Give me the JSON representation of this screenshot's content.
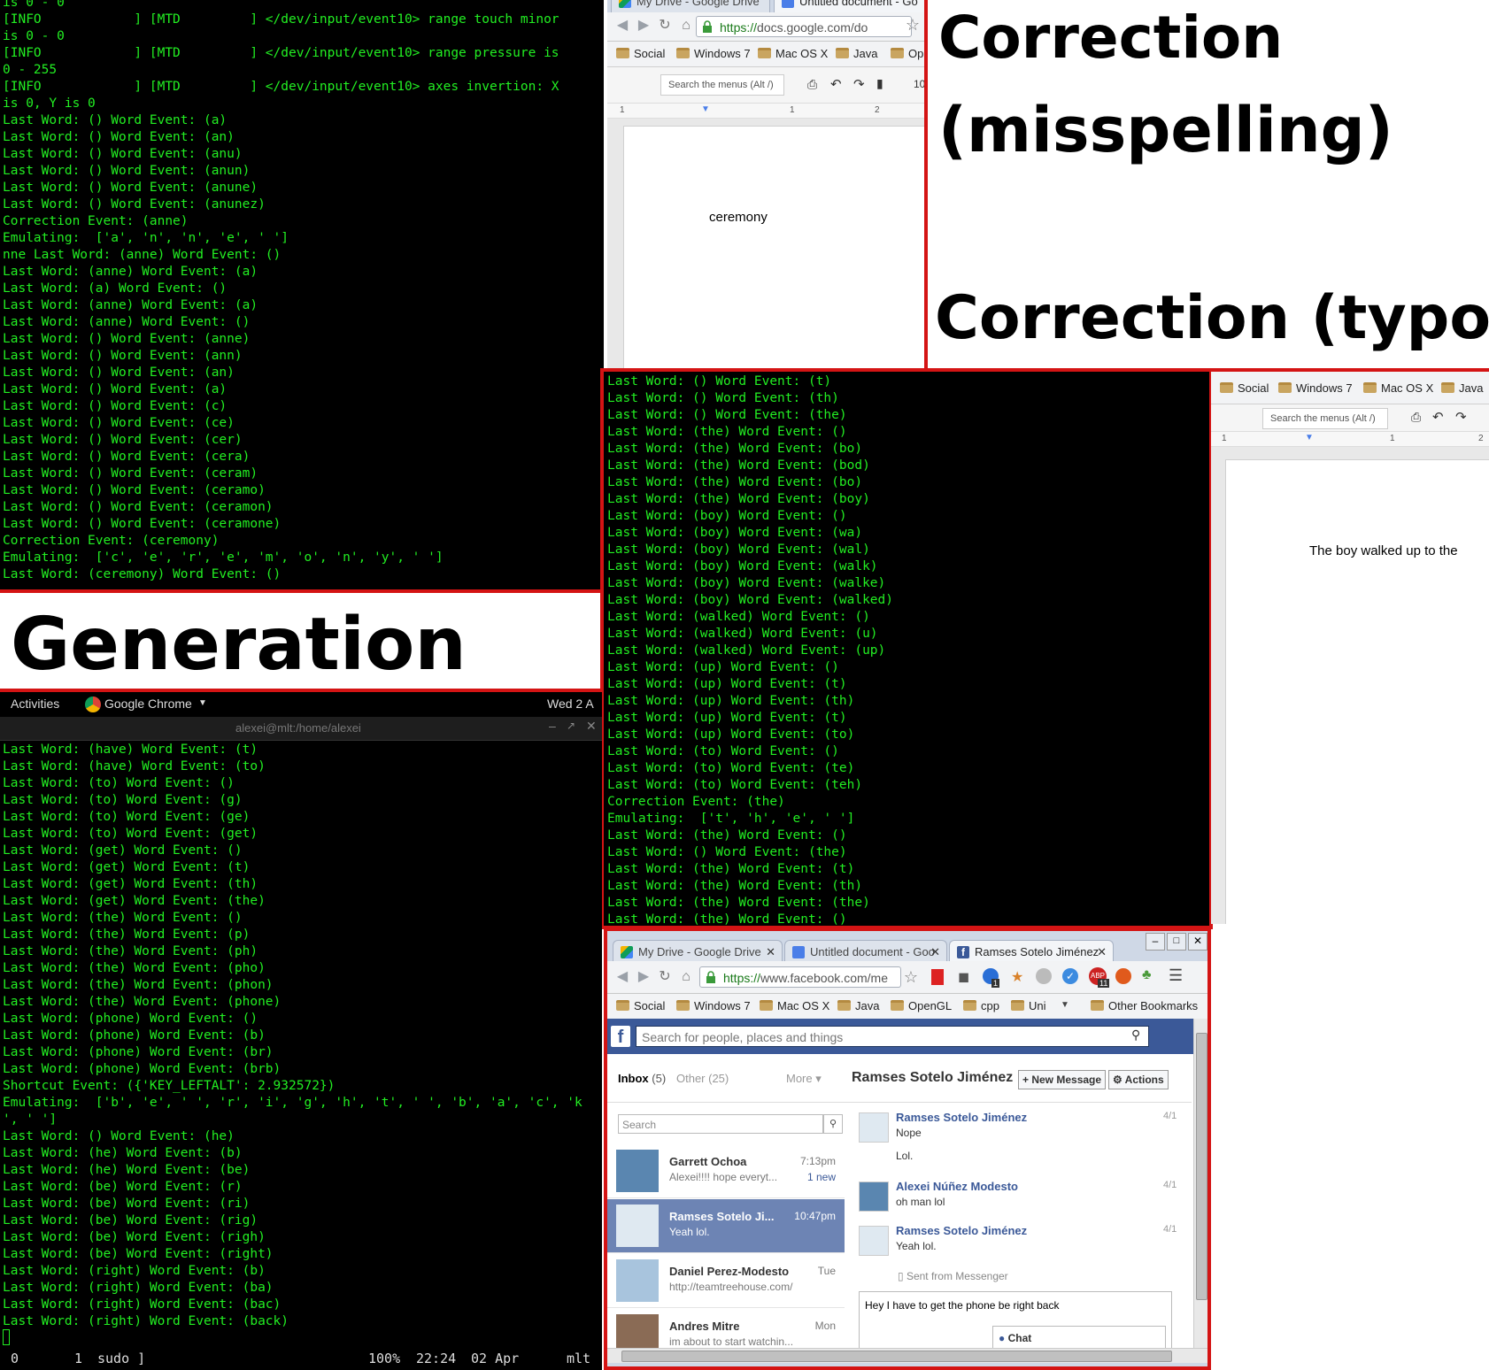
{
  "terminal_top": {
    "lines": [
      "is 0 - 0",
      "[INFO            ] [MTD         ] </dev/input/event10> range touch minor",
      "is 0 - 0",
      "[INFO            ] [MTD         ] </dev/input/event10> range pressure is",
      "0 - 255",
      "[INFO            ] [MTD         ] </dev/input/event10> axes invertion: X",
      "is 0, Y is 0",
      "Last Word: () Word Event: (a)",
      "Last Word: () Word Event: (an)",
      "Last Word: () Word Event: (anu)",
      "Last Word: () Word Event: (anun)",
      "Last Word: () Word Event: (anune)",
      "Last Word: () Word Event: (anunez)",
      "Correction Event: (anne)",
      "Emulating:  ['a', 'n', 'n', 'e', ' ']",
      "nne Last Word: (anne) Word Event: ()",
      "Last Word: (anne) Word Event: (a)",
      "Last Word: (a) Word Event: ()",
      "Last Word: (anne) Word Event: (a)",
      "Last Word: (anne) Word Event: ()",
      "Last Word: () Word Event: (anne)",
      "Last Word: () Word Event: (ann)",
      "Last Word: () Word Event: (an)",
      "Last Word: () Word Event: (a)",
      "Last Word: () Word Event: (c)",
      "Last Word: () Word Event: (ce)",
      "Last Word: () Word Event: (cer)",
      "Last Word: () Word Event: (cera)",
      "Last Word: () Word Event: (ceram)",
      "Last Word: () Word Event: (ceramo)",
      "Last Word: () Word Event: (ceramon)",
      "Last Word: () Word Event: (ceramone)",
      "Correction Event: (ceremony)",
      "Emulating:  ['c', 'e', 'r', 'e', 'm', 'o', 'n', 'y', ' ']",
      "Last Word: (ceremony) Word Event: ()"
    ]
  },
  "docs_top": {
    "tabs": [
      "My Drive - Google Drive",
      "Untitled document - Go"
    ],
    "url_https": "https://",
    "url_rest": "docs.google.com/do",
    "bookmarks": [
      "Social",
      "Windows 7",
      "Mac OS X",
      "Java",
      "Op"
    ],
    "search_menus": "Search the menus (Alt /)",
    "zoom_partial": "10",
    "ruler": [
      "1",
      "1",
      "2"
    ],
    "doc_text": "ceremony"
  },
  "labels": {
    "misspelling_1": "Correction",
    "misspelling_2": "(misspelling)",
    "typo": "Correction (typo)",
    "generation": "Generation"
  },
  "terminal_mid": {
    "lines": [
      "Last Word: () Word Event: (t)",
      "Last Word: () Word Event: (th)",
      "Last Word: () Word Event: (the)",
      "Last Word: (the) Word Event: ()",
      "Last Word: (the) Word Event: (bo)",
      "Last Word: (the) Word Event: (bod)",
      "Last Word: (the) Word Event: (bo)",
      "Last Word: (the) Word Event: (boy)",
      "Last Word: (boy) Word Event: ()",
      "Last Word: (boy) Word Event: (wa)",
      "Last Word: (boy) Word Event: (wal)",
      "Last Word: (boy) Word Event: (walk)",
      "Last Word: (boy) Word Event: (walke)",
      "Last Word: (boy) Word Event: (walked)",
      "Last Word: (walked) Word Event: ()",
      "Last Word: (walked) Word Event: (u)",
      "Last Word: (walked) Word Event: (up)",
      "Last Word: (up) Word Event: ()",
      "Last Word: (up) Word Event: (t)",
      "Last Word: (up) Word Event: (th)",
      "Last Word: (up) Word Event: (t)",
      "Last Word: (up) Word Event: (to)",
      "Last Word: (to) Word Event: ()",
      "Last Word: (to) Word Event: (te)",
      "Last Word: (to) Word Event: (teh)",
      "Correction Event: (the)",
      "Emulating:  ['t', 'h', 'e', ' ']",
      "Last Word: (the) Word Event: ()",
      "Last Word: () Word Event: (the)",
      "Last Word: (the) Word Event: (t)",
      "Last Word: (the) Word Event: (th)",
      "Last Word: (the) Word Event: (the)",
      "Last Word: (the) Word Event: ()"
    ]
  },
  "docs_mid": {
    "bookmarks": [
      "Social",
      "Windows 7",
      "Mac OS X",
      "Java"
    ],
    "search_menus": "Search the menus (Alt /)",
    "ruler": [
      "1",
      "1",
      "2"
    ],
    "doc_text": "The boy walked up to the"
  },
  "gnome": {
    "activities": "Activities",
    "app": "Google Chrome",
    "clock": "Wed 2 A",
    "window_title": "alexei@mlt:/home/alexei"
  },
  "terminal_bottom": {
    "lines": [
      "Last Word: (have) Word Event: (t)",
      "Last Word: (have) Word Event: (to)",
      "Last Word: (to) Word Event: ()",
      "Last Word: (to) Word Event: (g)",
      "Last Word: (to) Word Event: (ge)",
      "Last Word: (to) Word Event: (get)",
      "Last Word: (get) Word Event: ()",
      "Last Word: (get) Word Event: (t)",
      "Last Word: (get) Word Event: (th)",
      "Last Word: (get) Word Event: (the)",
      "Last Word: (the) Word Event: ()",
      "Last Word: (the) Word Event: (p)",
      "Last Word: (the) Word Event: (ph)",
      "Last Word: (the) Word Event: (pho)",
      "Last Word: (the) Word Event: (phon)",
      "Last Word: (the) Word Event: (phone)",
      "Last Word: (phone) Word Event: ()",
      "Last Word: (phone) Word Event: (b)",
      "Last Word: (phone) Word Event: (br)",
      "Last Word: (phone) Word Event: (brb)",
      "Shortcut Event: ({'KEY_LEFTALT': 2.932572})",
      "Emulating:  ['b', 'e', ' ', 'r', 'i', 'g', 'h', 't', ' ', 'b', 'a', 'c', 'k",
      "', ' ']",
      "Last Word: () Word Event: (he)",
      "Last Word: (he) Word Event: (b)",
      "Last Word: (he) Word Event: (be)",
      "Last Word: (be) Word Event: (r)",
      "Last Word: (be) Word Event: (ri)",
      "Last Word: (be) Word Event: (rig)",
      "Last Word: (be) Word Event: (righ)",
      "Last Word: (be) Word Event: (right)",
      "Last Word: (right) Word Event: (b)",
      "Last Word: (right) Word Event: (ba)",
      "Last Word: (right) Word Event: (bac)",
      "Last Word: (right) Word Event: (back)"
    ],
    "status_ws0": "0",
    "status_ws1": "1",
    "status_cmd": "sudo ]",
    "status_zoom": "100%",
    "status_time": "22:24",
    "status_date": "02 Apr",
    "status_host": "mlt"
  },
  "facebook": {
    "tabs": [
      "My Drive - Google Drive",
      "Untitled document - Goo",
      "Ramses Sotelo Jiménez"
    ],
    "url_https": "https://",
    "url_rest": "www.facebook.com/me",
    "ext_badge_1": "1",
    "ext_badge_abp": "11",
    "bookmarks": [
      "Social",
      "Windows 7",
      "Mac OS X",
      "Java",
      "OpenGL",
      "cpp",
      "Uni"
    ],
    "other_bookmarks": "Other Bookmarks",
    "search_placeholder": "Search for people, places and things",
    "inbox_label": "Inbox",
    "inbox_count": "(5)",
    "other_label": "Other (25)",
    "more_label": "More",
    "sidebar_search": "Search",
    "conv_title": "Ramses Sotelo Jiménez",
    "new_message": "New Message",
    "actions": "Actions",
    "threads": [
      {
        "name": "Garrett Ochoa",
        "time": "7:13pm",
        "snippet": "Alexei!!!! hope everyt...",
        "extra": "1 new"
      },
      {
        "name": "Ramses Sotelo Ji...",
        "time": "10:47pm",
        "snippet": "Yeah lol.",
        "extra": ""
      },
      {
        "name": "Daniel Perez-Modesto",
        "time": "Tue",
        "snippet": "http://teamtreehouse.com/",
        "extra": ""
      },
      {
        "name": "Andres Mitre",
        "time": "Mon",
        "snippet": "im about to start watchin...",
        "extra": ""
      }
    ],
    "messages": [
      {
        "author": "Ramses Sotelo Jiménez",
        "date": "4/1",
        "lines": [
          "Nope",
          "Lol."
        ]
      },
      {
        "author": "Alexei Núñez Modesto",
        "date": "4/1",
        "lines": [
          "oh man lol"
        ]
      },
      {
        "author": "Ramses Sotelo Jiménez",
        "date": "4/1",
        "lines": [
          "Yeah lol."
        ]
      }
    ],
    "sent_from": "Sent from Messenger",
    "reply_text": "Hey I have to get the phone be right back",
    "chat_label": "Chat"
  },
  "colors": {
    "terminal_text": "#22ee22",
    "frame_red": "#d41414",
    "fb_blue": "#3b5998",
    "fb_selected": "#6d84b4"
  }
}
